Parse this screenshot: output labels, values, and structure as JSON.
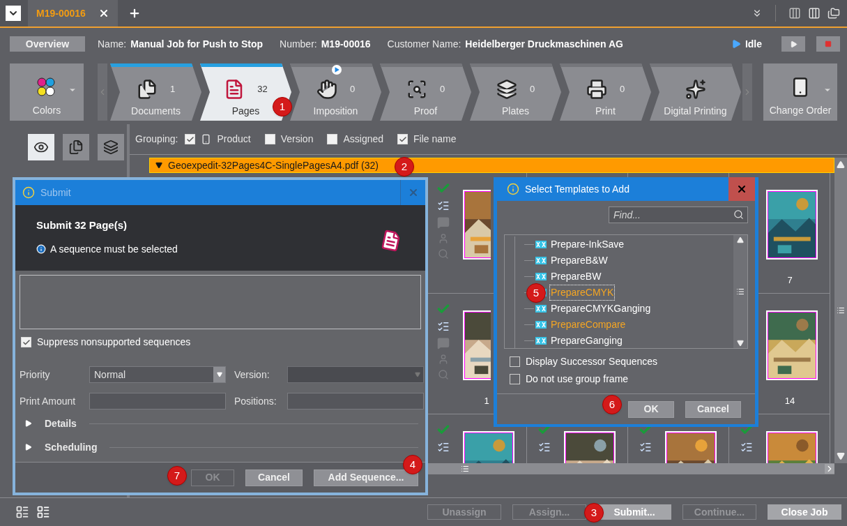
{
  "tabs": [
    {
      "label": "M19-00016",
      "selected": true
    }
  ],
  "info": {
    "overview": "Overview",
    "fields": [
      {
        "label": "Name:",
        "value": "Manual Job for Push to Stop"
      },
      {
        "label": "Number:",
        "value": "M19-00016"
      },
      {
        "label": "Customer Name:",
        "value": "Heidelberger Druckmaschinen AG"
      }
    ],
    "status": "Idle"
  },
  "colors": {
    "label": "Colors"
  },
  "steps": [
    {
      "label": "Documents",
      "count": "1",
      "selected": false,
      "done": true,
      "running": false
    },
    {
      "label": "Pages",
      "count": "32",
      "selected": true,
      "done": true,
      "running": false
    },
    {
      "label": "Imposition",
      "count": "0",
      "selected": false,
      "done": false,
      "running": true
    },
    {
      "label": "Proof",
      "count": "0",
      "selected": false,
      "done": false,
      "running": false
    },
    {
      "label": "Plates",
      "count": "0",
      "selected": false,
      "done": false,
      "running": false
    },
    {
      "label": "Print",
      "count": "0",
      "selected": false,
      "done": false,
      "running": false
    },
    {
      "label": "Digital Printing",
      "selected": false,
      "done": false,
      "running": false
    }
  ],
  "change_order": {
    "label": "Change Order"
  },
  "grouping": {
    "label": "Grouping:",
    "options": [
      {
        "label": "Product",
        "checked": true
      },
      {
        "label": "Version",
        "checked": false
      },
      {
        "label": "Assigned",
        "checked": false
      },
      {
        "label": "File name",
        "checked": true
      }
    ]
  },
  "group_header": {
    "label": "Geoexpedit-32Pages4C-SinglePagesA4.pdf (32)",
    "expanded": true
  },
  "page_numbers": [
    "7",
    "1",
    "14"
  ],
  "submit_dialog": {
    "title": "Submit",
    "heading": "Submit 32 Page(s)",
    "message": "A sequence must be selected",
    "suppress": {
      "label": "Suppress nonsupported sequences",
      "checked": true
    },
    "priority": {
      "label": "Priority",
      "value": "Normal"
    },
    "version": {
      "label": "Version:"
    },
    "print_amount": {
      "label": "Print Amount"
    },
    "positions": {
      "label": "Positions:"
    },
    "sections": [
      {
        "label": "Details",
        "expanded": false
      },
      {
        "label": "Scheduling",
        "expanded": false
      }
    ],
    "buttons": [
      {
        "label": "OK",
        "disabled": true
      },
      {
        "label": "Cancel",
        "disabled": false
      },
      {
        "label": "Add Sequence...",
        "disabled": false
      }
    ]
  },
  "templates_dialog": {
    "title": "Select Templates to Add",
    "search": {
      "placeholder": "Find..."
    },
    "items": [
      {
        "label": "Prepare-InkSave",
        "selected": false,
        "highlighted": false
      },
      {
        "label": "PrepareB&W",
        "selected": false,
        "highlighted": false
      },
      {
        "label": "PrepareBW",
        "selected": false,
        "highlighted": false
      },
      {
        "label": "PrepareCMYK",
        "selected": true,
        "highlighted": true
      },
      {
        "label": "PrepareCMYKGanging",
        "selected": false,
        "highlighted": false
      },
      {
        "label": "PrepareCompare",
        "selected": false,
        "highlighted": true
      },
      {
        "label": "PrepareGanging",
        "selected": false,
        "highlighted": false
      }
    ],
    "options": [
      {
        "label": "Display Successor Sequences",
        "checked": false
      },
      {
        "label": "Do not use group frame",
        "checked": false
      }
    ],
    "buttons": [
      {
        "label": "OK",
        "disabled": false
      },
      {
        "label": "Cancel",
        "disabled": false
      }
    ]
  },
  "bottom_buttons": [
    {
      "label": "Unassign",
      "disabled": true
    },
    {
      "label": "Assign...",
      "disabled": true
    },
    {
      "label": "Submit...",
      "disabled": false
    },
    {
      "label": "Continue...",
      "disabled": true
    },
    {
      "label": "Close Job",
      "disabled": false
    }
  ],
  "badges": [
    "1",
    "2",
    "3",
    "4",
    "5",
    "6",
    "7"
  ]
}
